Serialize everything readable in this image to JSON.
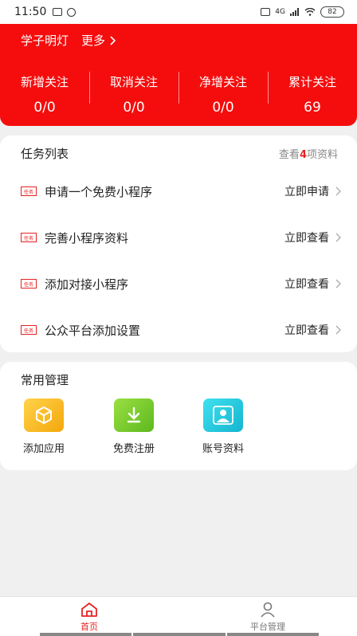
{
  "status_bar": {
    "time": "11:50",
    "network": "4G",
    "battery": "82"
  },
  "header": {
    "brand": "学子明灯",
    "more_label": "更多",
    "stats": [
      {
        "label": "新增关注",
        "value": "0/0"
      },
      {
        "label": "取消关注",
        "value": "0/0"
      },
      {
        "label": "净增关注",
        "value": "0/0"
      },
      {
        "label": "累计关注",
        "value": "69"
      }
    ],
    "bg_color": "#f50d0d"
  },
  "tasks": {
    "title": "任务列表",
    "view_prefix": "查看",
    "view_count": "4",
    "view_suffix": "项资料",
    "tag_label": "任务",
    "items": [
      {
        "name": "申请一个免费小程序",
        "action": "立即申请"
      },
      {
        "name": "完善小程序资料",
        "action": "立即查看"
      },
      {
        "name": "添加对接小程序",
        "action": "立即查看"
      },
      {
        "name": "公众平台添加设置",
        "action": "立即查看"
      }
    ]
  },
  "tools": {
    "title": "常用管理",
    "items": [
      {
        "label": "添加应用",
        "icon": "box-icon",
        "color": "#f7b918"
      },
      {
        "label": "免费注册",
        "icon": "download-icon",
        "color": "#7ccf2b"
      },
      {
        "label": "账号资料",
        "icon": "user-icon",
        "color": "#22c7dd"
      }
    ]
  },
  "tabbar": {
    "items": [
      {
        "label": "首页",
        "icon": "home-icon",
        "active": true
      },
      {
        "label": "平台管理",
        "icon": "person-icon",
        "active": false
      }
    ]
  },
  "accent_color": "#e62222"
}
